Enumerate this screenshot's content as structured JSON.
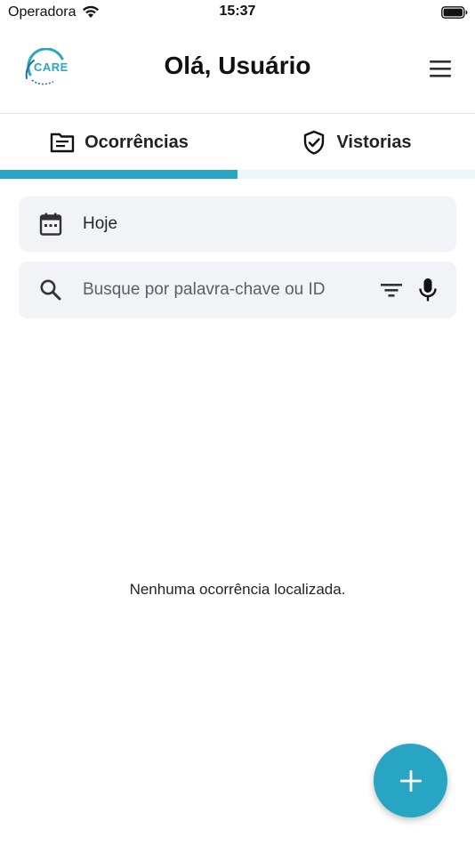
{
  "status_bar": {
    "carrier": "Operadora",
    "time": "15:37"
  },
  "header": {
    "logo_text": "CARE",
    "title": "Olá, Usuário"
  },
  "tabs": [
    {
      "label": "Ocorrências",
      "icon": "document-list-icon",
      "active": true
    },
    {
      "label": "Vistorias",
      "icon": "shield-check-icon",
      "active": false
    }
  ],
  "filters": {
    "date_value": "Hoje",
    "search_placeholder": "Busque por palavra-chave ou ID",
    "search_value": ""
  },
  "empty_state": {
    "message": "Nenhuma ocorrência localizada."
  },
  "colors": {
    "accent": "#28a5c3",
    "tab_track": "#eaf6fa",
    "field_background": "#f2f3f7"
  }
}
